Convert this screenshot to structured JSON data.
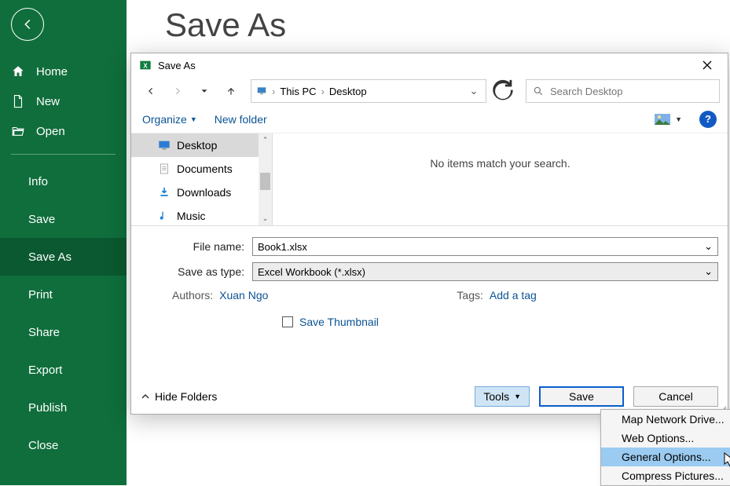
{
  "page": {
    "title": "Save As"
  },
  "sidebar": {
    "items": [
      {
        "label": "Home",
        "icon": "home"
      },
      {
        "label": "New",
        "icon": "file"
      },
      {
        "label": "Open",
        "icon": "folder-open"
      }
    ],
    "sub": [
      "Info",
      "Save",
      "Save As",
      "Print",
      "Share",
      "Export",
      "Publish",
      "Close"
    ],
    "selected": "Save As"
  },
  "dialog": {
    "title": "Save As",
    "breadcrumbs": [
      "This PC",
      "Desktop"
    ],
    "search_placeholder": "Search Desktop",
    "toolbar": {
      "organize": "Organize",
      "newfolder": "New folder"
    },
    "tree": [
      {
        "label": "Desktop",
        "icon": "desktop",
        "selected": true
      },
      {
        "label": "Documents",
        "icon": "document"
      },
      {
        "label": "Downloads",
        "icon": "download"
      },
      {
        "label": "Music",
        "icon": "music"
      }
    ],
    "empty": "No items match your search.",
    "filename_label": "File name:",
    "filename": "Book1.xlsx",
    "type_label": "Save as type:",
    "type": "Excel Workbook (*.xlsx)",
    "authors_label": "Authors:",
    "authors": "Xuan Ngo",
    "tags_label": "Tags:",
    "tags": "Add a tag",
    "save_thumbnail": "Save Thumbnail",
    "hide_folders": "Hide Folders",
    "tools": "Tools",
    "save": "Save",
    "cancel": "Cancel"
  },
  "tools_menu": {
    "items": [
      "Map Network Drive...",
      "Web Options...",
      "General Options...",
      "Compress Pictures..."
    ],
    "hover_index": 2
  }
}
